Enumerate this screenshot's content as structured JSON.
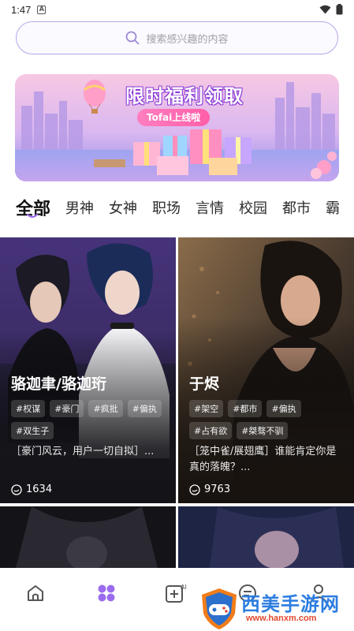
{
  "status_bar": {
    "time": "1:47",
    "notification_badge": "A"
  },
  "search": {
    "placeholder": "搜索感兴趣的内容"
  },
  "banner": {
    "title": "限时福利领取",
    "subtitle": "Tofai上线啦"
  },
  "tabs": [
    {
      "label": "全部",
      "active": true
    },
    {
      "label": "男神"
    },
    {
      "label": "女神"
    },
    {
      "label": "职场"
    },
    {
      "label": "言情"
    },
    {
      "label": "校园"
    },
    {
      "label": "都市"
    },
    {
      "label": "霸"
    }
  ],
  "cards": [
    {
      "name": "骆迦聿/骆迦珩",
      "tags": [
        "#权谋",
        "#豪门",
        "#疯批",
        "#偏执",
        "#双生子"
      ],
      "description": "［豪门风云，用户一切自拟］...",
      "count": "1634"
    },
    {
      "name": "于烬",
      "tags": [
        "#架空",
        "#都市",
        "#偏执",
        "#占有欲",
        "#桀骜不驯"
      ],
      "description": "［笼中雀/展翅鹰］谁能肯定你是真的落魄？...",
      "count": "9763"
    }
  ],
  "bottom_nav": [
    {
      "name": "home-icon"
    },
    {
      "name": "discover-icon",
      "active": true
    },
    {
      "name": "ai-create-icon",
      "badge": "AI"
    },
    {
      "name": "messages-icon"
    },
    {
      "name": "profile-icon"
    }
  ],
  "watermark": {
    "brand": "西美手游网",
    "url": "www.hanxm.com"
  },
  "colors": {
    "accent": "#9b6cf0",
    "search_border": "#b9a6e8"
  }
}
